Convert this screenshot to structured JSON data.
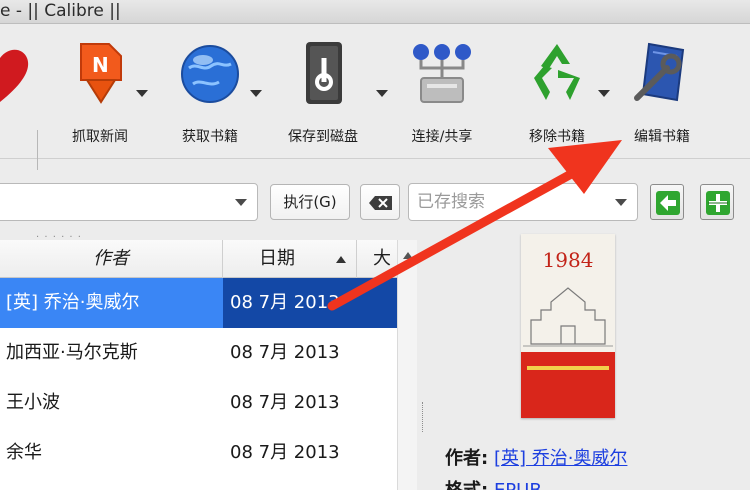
{
  "window": {
    "title": "e - || Calibre ||"
  },
  "toolbar": {
    "items": [
      {
        "label": "抓取新闻",
        "icon": "news-fetch-icon"
      },
      {
        "label": "获取书籍",
        "icon": "globe-icon"
      },
      {
        "label": "保存到磁盘",
        "icon": "disk-save-icon"
      },
      {
        "label": "连接/共享",
        "icon": "network-share-icon"
      },
      {
        "label": "移除书籍",
        "icon": "recycle-icon"
      },
      {
        "label": "编辑书籍",
        "icon": "book-edit-icon"
      }
    ]
  },
  "search": {
    "execute_label": "执行(G)",
    "saved_placeholder": "已存搜索"
  },
  "table": {
    "columns": {
      "author": "作者",
      "date": "日期",
      "size": "大"
    },
    "rows": [
      {
        "author": "[英] 乔治·奥威尔",
        "date": "08 7月 2013",
        "selected": true
      },
      {
        "author": "加西亚·马尔克斯",
        "date": "08 7月 2013"
      },
      {
        "author": "王小波",
        "date": "08 7月 2013"
      },
      {
        "author": "余华",
        "date": "08 7月 2013"
      }
    ]
  },
  "details": {
    "cover_title": "1984",
    "author_key": "作者:",
    "author_value": "[英] 乔治·奥威尔",
    "format_key": "格式:",
    "format_value": "EPUB"
  },
  "colors": {
    "selection": "#1a63d6",
    "arrow": "#f0341e",
    "link": "#1d3fe0"
  }
}
